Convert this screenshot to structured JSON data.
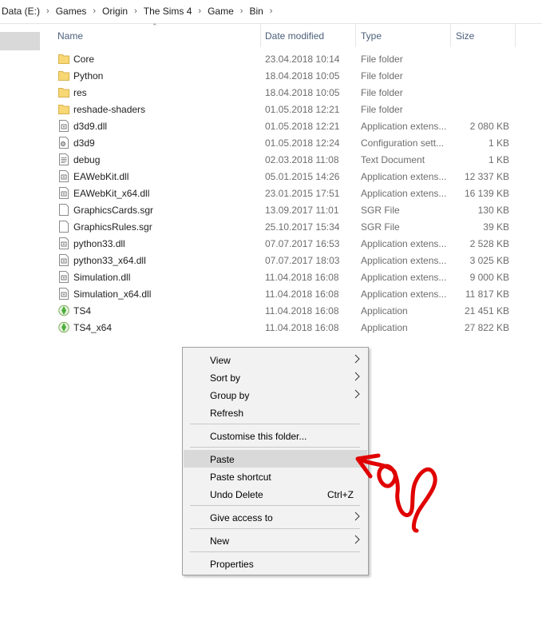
{
  "breadcrumb": [
    "Data (E:)",
    "Games",
    "Origin",
    "The Sims 4",
    "Game",
    "Bin"
  ],
  "columns": {
    "name": "Name",
    "date": "Date modified",
    "type": "Type",
    "size": "Size"
  },
  "files": [
    {
      "name": "Core",
      "date": "23.04.2018 10:14",
      "type": "File folder",
      "size": "",
      "icon": "folder-icon"
    },
    {
      "name": "Python",
      "date": "18.04.2018 10:05",
      "type": "File folder",
      "size": "",
      "icon": "folder-icon"
    },
    {
      "name": "res",
      "date": "18.04.2018 10:05",
      "type": "File folder",
      "size": "",
      "icon": "folder-icon"
    },
    {
      "name": "reshade-shaders",
      "date": "01.05.2018 12:21",
      "type": "File folder",
      "size": "",
      "icon": "folder-icon"
    },
    {
      "name": "d3d9.dll",
      "date": "01.05.2018 12:21",
      "type": "Application extens...",
      "size": "2 080 KB",
      "icon": "dll-file-icon"
    },
    {
      "name": "d3d9",
      "date": "01.05.2018 12:24",
      "type": "Configuration sett...",
      "size": "1 KB",
      "icon": "config-file-icon"
    },
    {
      "name": "debug",
      "date": "02.03.2018 11:08",
      "type": "Text Document",
      "size": "1 KB",
      "icon": "text-file-icon"
    },
    {
      "name": "EAWebKit.dll",
      "date": "05.01.2015 14:26",
      "type": "Application extens...",
      "size": "12 337 KB",
      "icon": "dll-file-icon"
    },
    {
      "name": "EAWebKit_x64.dll",
      "date": "23.01.2015 17:51",
      "type": "Application extens...",
      "size": "16 139 KB",
      "icon": "dll-file-icon"
    },
    {
      "name": "GraphicsCards.sgr",
      "date": "13.09.2017 11:01",
      "type": "SGR File",
      "size": "130 KB",
      "icon": "blank-file-icon"
    },
    {
      "name": "GraphicsRules.sgr",
      "date": "25.10.2017 15:34",
      "type": "SGR File",
      "size": "39 KB",
      "icon": "blank-file-icon"
    },
    {
      "name": "python33.dll",
      "date": "07.07.2017 16:53",
      "type": "Application extens...",
      "size": "2 528 KB",
      "icon": "dll-file-icon"
    },
    {
      "name": "python33_x64.dll",
      "date": "07.07.2017 18:03",
      "type": "Application extens...",
      "size": "3 025 KB",
      "icon": "dll-file-icon"
    },
    {
      "name": "Simulation.dll",
      "date": "11.04.2018 16:08",
      "type": "Application extens...",
      "size": "9 000 KB",
      "icon": "dll-file-icon"
    },
    {
      "name": "Simulation_x64.dll",
      "date": "11.04.2018 16:08",
      "type": "Application extens...",
      "size": "11 817 KB",
      "icon": "dll-file-icon"
    },
    {
      "name": "TS4",
      "date": "11.04.2018 16:08",
      "type": "Application",
      "size": "21 451 KB",
      "icon": "sims-plumbob-icon"
    },
    {
      "name": "TS4_x64",
      "date": "11.04.2018 16:08",
      "type": "Application",
      "size": "27 822 KB",
      "icon": "sims-plumbob-icon"
    }
  ],
  "context_menu": {
    "items": [
      {
        "label": "View",
        "submenu": true
      },
      {
        "label": "Sort by",
        "submenu": true
      },
      {
        "label": "Group by",
        "submenu": true
      },
      {
        "label": "Refresh"
      },
      {
        "separator": true
      },
      {
        "label": "Customise this folder..."
      },
      {
        "separator": true
      },
      {
        "label": "Paste",
        "highlighted": true
      },
      {
        "label": "Paste shortcut"
      },
      {
        "label": "Undo Delete",
        "shortcut": "Ctrl+Z"
      },
      {
        "separator": true
      },
      {
        "label": "Give access to",
        "submenu": true
      },
      {
        "separator": true
      },
      {
        "label": "New",
        "submenu": true
      },
      {
        "separator": true
      },
      {
        "label": "Properties"
      }
    ]
  },
  "colors": {
    "folder": "#f8d775",
    "highlight": "#d9d9d9",
    "annotation": "#e00000"
  },
  "annotation": {
    "icon": "red-hand-drawn-arrow",
    "points_to": "Paste"
  }
}
